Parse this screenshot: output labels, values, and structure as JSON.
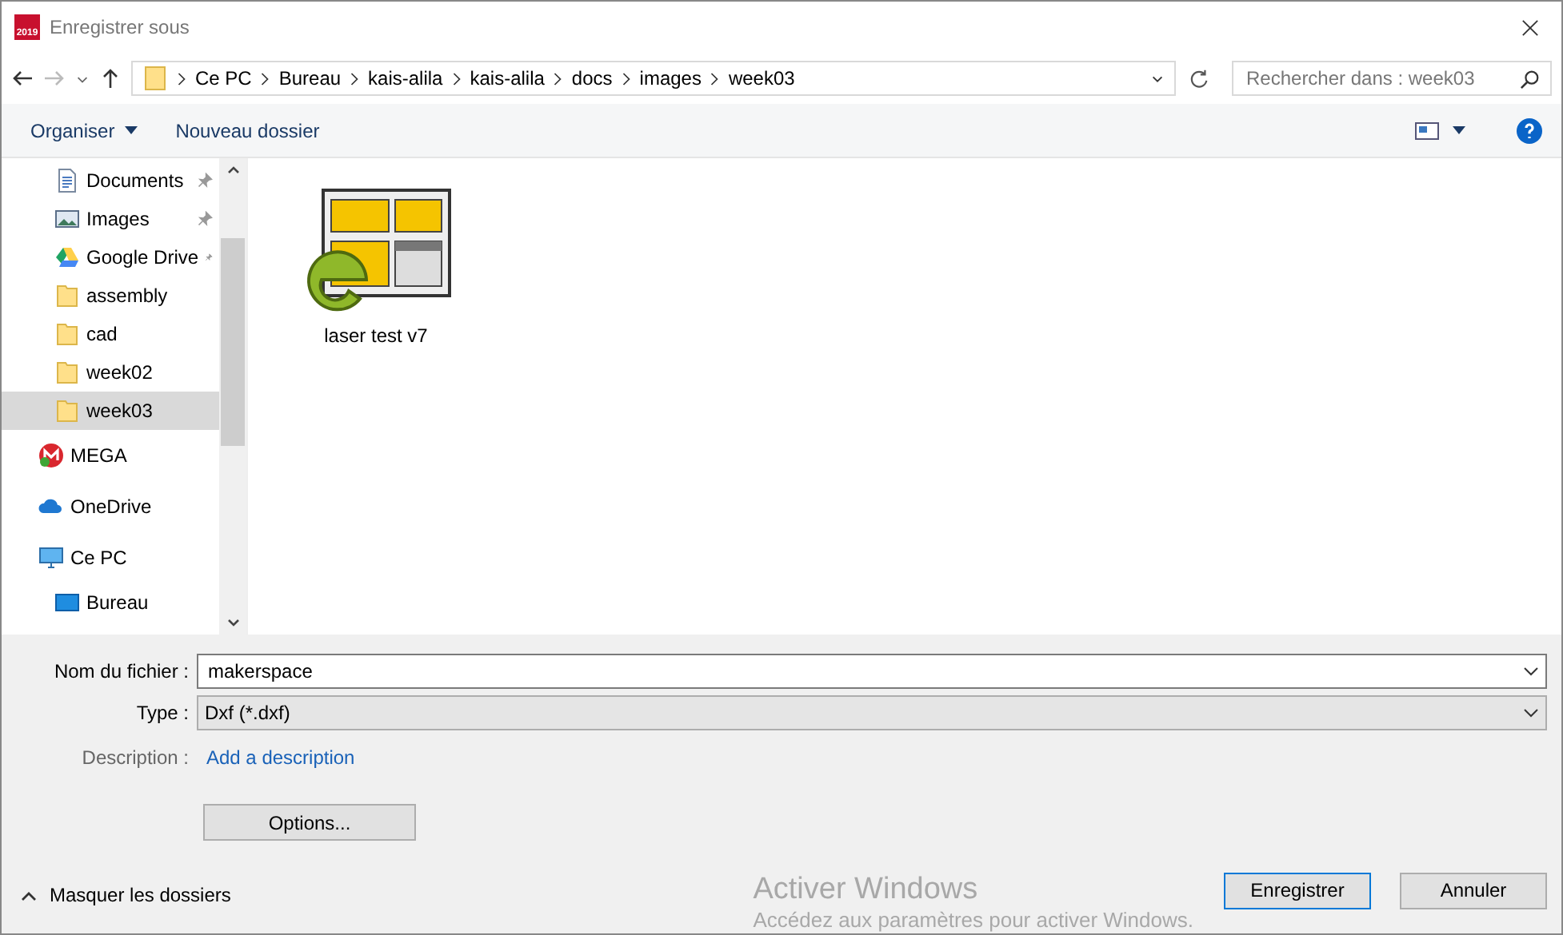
{
  "window": {
    "title": "Enregistrer sous",
    "app_badge": "2019"
  },
  "address_bar": {
    "path": [
      "Ce PC",
      "Bureau",
      "kais-alila",
      "kais-alila",
      "docs",
      "images",
      "week03"
    ]
  },
  "search": {
    "placeholder": "Rechercher dans : week03"
  },
  "toolbar": {
    "buttons": [
      "Organiser",
      "Nouveau dossier"
    ]
  },
  "sidebar": {
    "quick_access_items": [
      {
        "label": "Documents",
        "kind": "document",
        "pinned": true,
        "selected": false
      },
      {
        "label": "Images",
        "kind": "images",
        "pinned": true,
        "selected": false
      },
      {
        "label": "Google Drive",
        "kind": "drive",
        "pinned": true,
        "selected": false
      },
      {
        "label": "assembly",
        "kind": "folder",
        "pinned": false,
        "selected": false
      },
      {
        "label": "cad",
        "kind": "folder",
        "pinned": false,
        "selected": false
      },
      {
        "label": "week02",
        "kind": "folder",
        "pinned": false,
        "selected": false
      },
      {
        "label": "week03",
        "kind": "folder",
        "pinned": false,
        "selected": true
      }
    ],
    "items": [
      {
        "label": "MEGA",
        "kind": "mega",
        "selected": false
      },
      {
        "label": "OneDrive",
        "kind": "cloud",
        "selected": false
      },
      {
        "label": "Ce PC",
        "kind": "pc",
        "selected": false,
        "children": [
          {
            "label": "Bureau",
            "kind": "desktop",
            "selected": false
          }
        ]
      }
    ]
  },
  "files": [
    {
      "name": "laser test v7",
      "selected": false
    }
  ],
  "form": {
    "filename_label": "Nom du fichier :",
    "filename": "makerspace",
    "type_label": "Type :",
    "type": "Dxf (*.dxf)",
    "description_label": "Description :",
    "description_link": "Add a description",
    "options_button": "Options..."
  },
  "footer": {
    "toggle": "Masquer les dossiers",
    "buttons": [
      "Enregistrer",
      "Annuler"
    ]
  },
  "activation_notice": {
    "title": "Activer Windows",
    "text": "Accédez aux paramètres pour activer Windows."
  }
}
